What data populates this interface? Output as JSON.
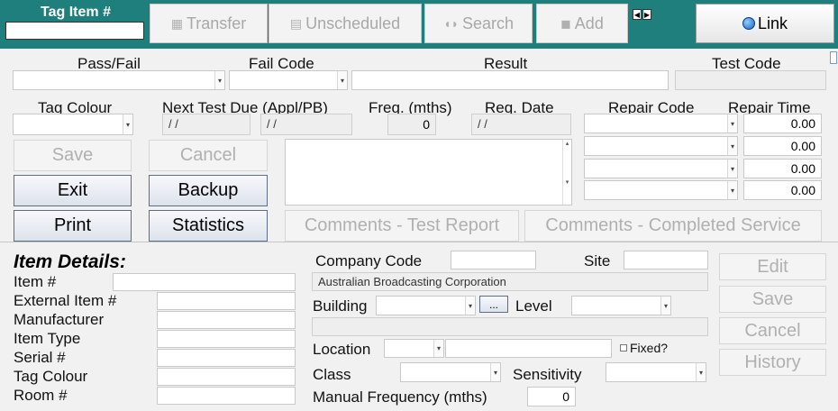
{
  "toolbar": {
    "tag_item_label": "Tag Item #",
    "tag_item_value": "",
    "transfer_label": "Transfer",
    "unscheduled_label": "Unscheduled",
    "search_label": "Search",
    "add_label": "Add",
    "prev_glyph": "◀",
    "next_glyph": "▶",
    "link_label": "Link"
  },
  "test": {
    "pass_fail_label": "Pass/Fail",
    "fail_code_label": "Fail Code",
    "result_label": "Result",
    "test_code_label": "Test Code",
    "tag_colour_label": "Tag Colour",
    "next_test_due_label": "Next Test Due (Appl/PB)",
    "next_due_appl": "/ /",
    "next_due_pb": "/ /",
    "freq_label": "Freq. (mths)",
    "freq_value": "0",
    "req_date_label": "Req. Date",
    "req_date_value": "/ /",
    "repair_code_label": "Repair Code",
    "repair_time_label": "Repair Time",
    "repair_times": [
      "0.00",
      "0.00",
      "0.00",
      "0.00"
    ]
  },
  "actions": {
    "save": "Save",
    "cancel": "Cancel",
    "exit": "Exit",
    "backup": "Backup",
    "print": "Print",
    "statistics": "Statistics",
    "comments_test_report": "Comments - Test Report",
    "comments_completed_service": "Comments - Completed Service"
  },
  "item": {
    "heading": "Item Details:",
    "item_no": "Item #",
    "external_item": "External Item #",
    "manufacturer": "Manufacturer",
    "item_type": "Item Type",
    "serial": "Serial #",
    "tag_colour": "Tag Colour",
    "room": "Room #",
    "company_code_label": "Company Code",
    "company_name": "Australian Broadcasting Corporation",
    "site_label": "Site",
    "building_label": "Building",
    "browse_label": "...",
    "level_label": "Level",
    "location_label": "Location",
    "fixed_label": "Fixed?",
    "class_label": "Class",
    "sensitivity_label": "Sensitivity",
    "manual_freq_label": "Manual Frequency (mths)",
    "manual_freq_value": "0",
    "edit": "Edit",
    "save": "Save",
    "cancel": "Cancel",
    "history": "History"
  }
}
